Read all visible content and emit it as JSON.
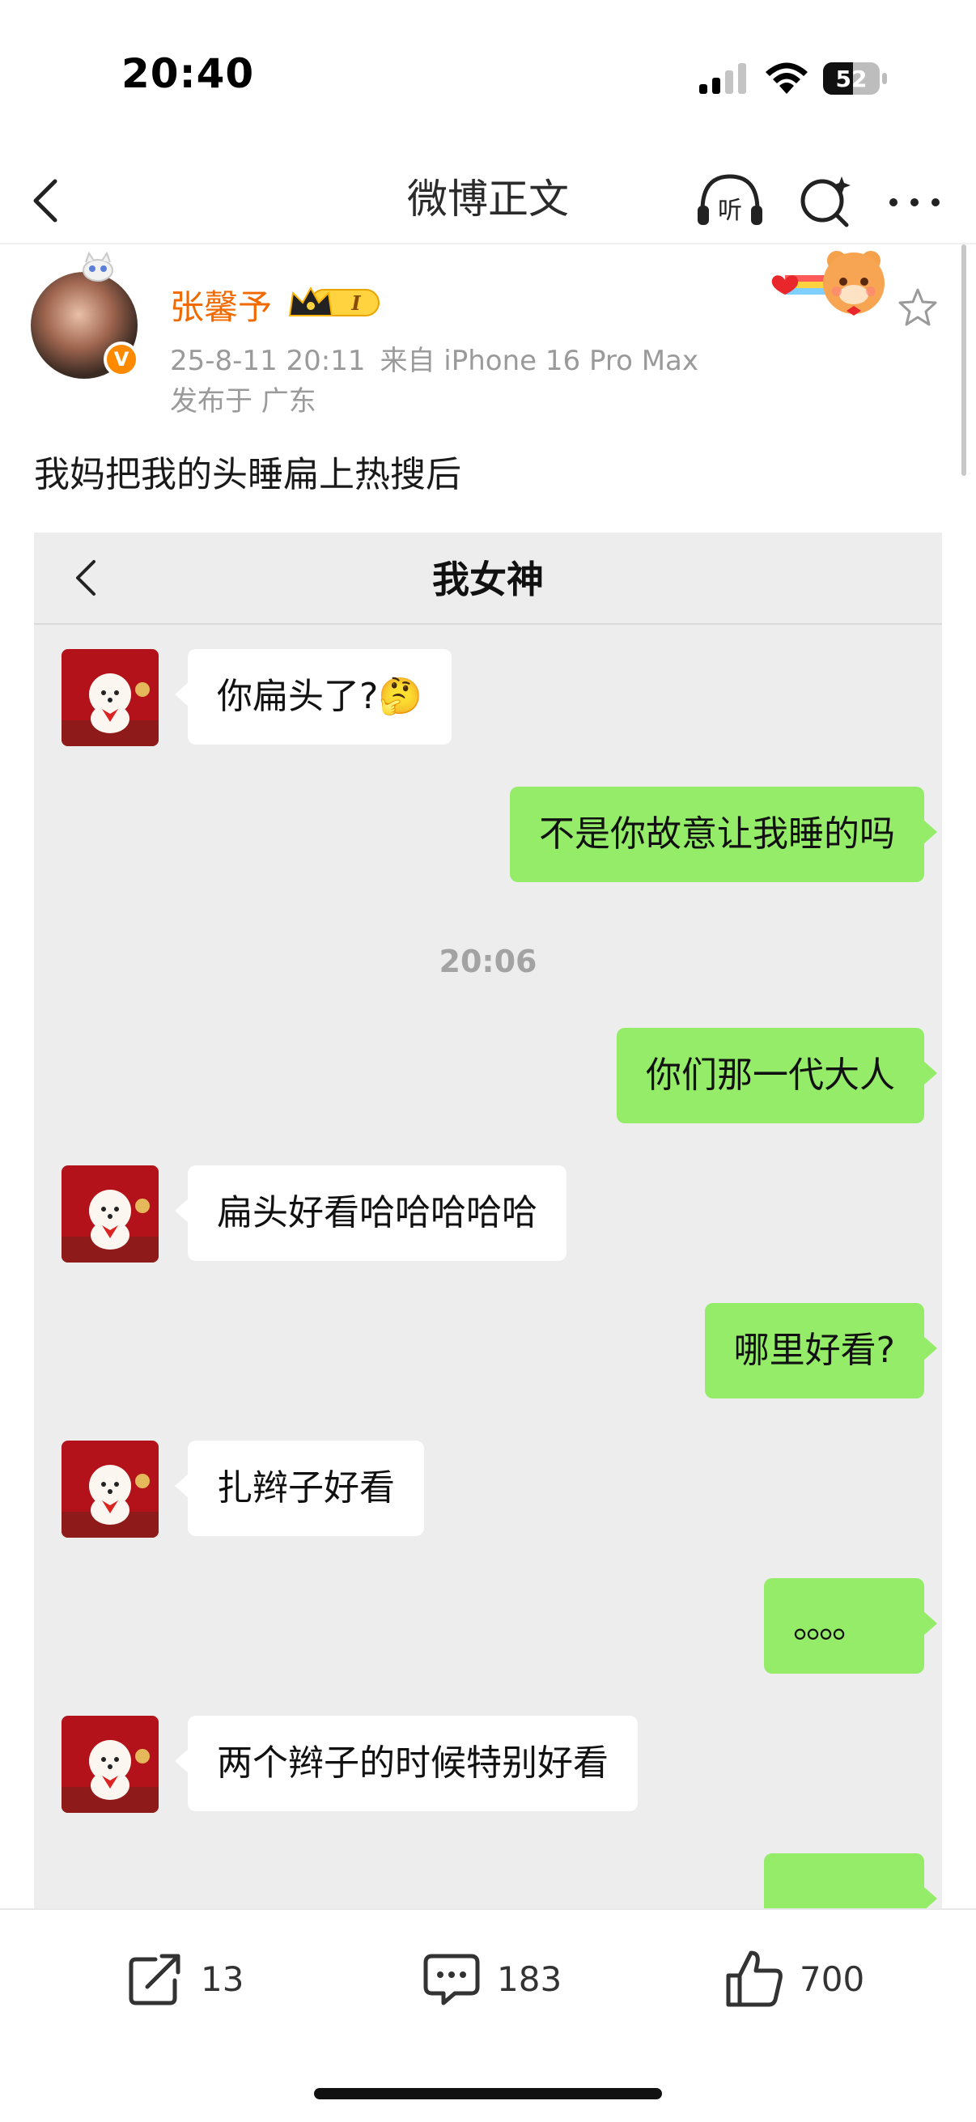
{
  "status_bar": {
    "time": "20:40",
    "battery": "52"
  },
  "nav": {
    "title": "微博正文",
    "listen_label": "听"
  },
  "post": {
    "username": "张馨予",
    "vip_level": "I",
    "verified_mark": "V",
    "date": "25-8-11 20:11",
    "source": "来自 iPhone 16 Pro Max",
    "location": "发布于 广东",
    "text": "我妈把我的头睡扁上热搜后"
  },
  "chat": {
    "title": "我女神",
    "messages": [
      {
        "side": "left",
        "text": "你扁头了?🤔"
      },
      {
        "side": "right",
        "text": "不是你故意让我睡的吗"
      },
      {
        "side": "time",
        "text": "20:06"
      },
      {
        "side": "right",
        "text": "你们那一代大人"
      },
      {
        "side": "left",
        "text": "扁头好看哈哈哈哈哈"
      },
      {
        "side": "right",
        "text": "哪里好看?"
      },
      {
        "side": "left",
        "text": "扎辫子好看"
      },
      {
        "side": "right",
        "text": "。。。。"
      },
      {
        "side": "left",
        "text": "两个辫子的时候特别好看"
      },
      {
        "side": "right",
        "text": ""
      }
    ]
  },
  "actions": {
    "reposts": "13",
    "comments": "183",
    "likes": "700"
  },
  "colors": {
    "username": "#f06a00",
    "sent_bubble": "#95ec69",
    "chat_bg": "#ededed"
  }
}
